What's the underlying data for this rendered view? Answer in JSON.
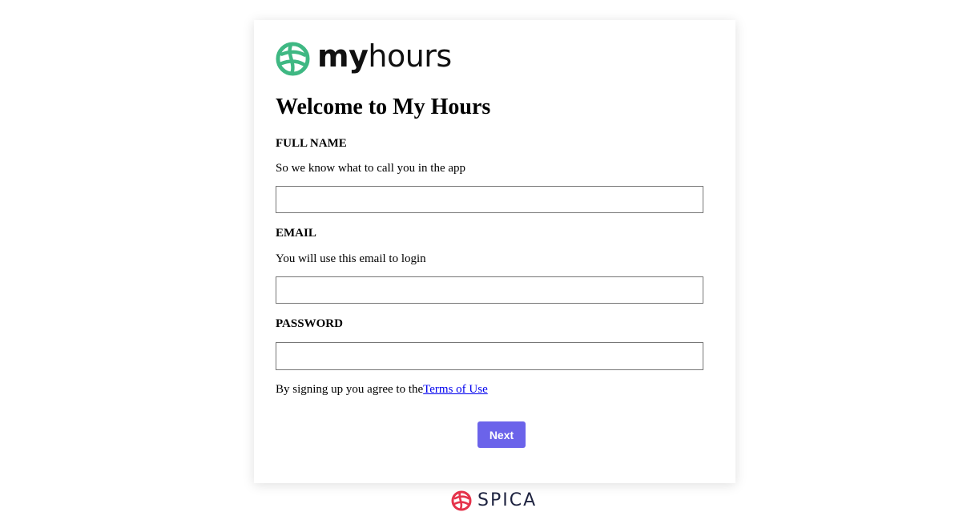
{
  "brand": {
    "logo_bold": "my",
    "logo_regular": "hours",
    "logo_color": "#3fb883"
  },
  "form": {
    "title": "Welcome to My Hours",
    "full_name": {
      "label": "FULL NAME",
      "help": "So we know what to call you in the app",
      "value": "",
      "placeholder": ""
    },
    "email": {
      "label": "EMAIL",
      "help": "You will use this email to login",
      "value": "",
      "placeholder": ""
    },
    "password": {
      "label": "PASSWORD",
      "value": "",
      "placeholder": ""
    },
    "terms_text": "By signing up you agree to the",
    "terms_link": "Terms of Use",
    "next_label": "Next",
    "button_color": "#6b63ea"
  },
  "footer": {
    "brand_name": "SPICA",
    "brand_color": "#e5334b"
  }
}
